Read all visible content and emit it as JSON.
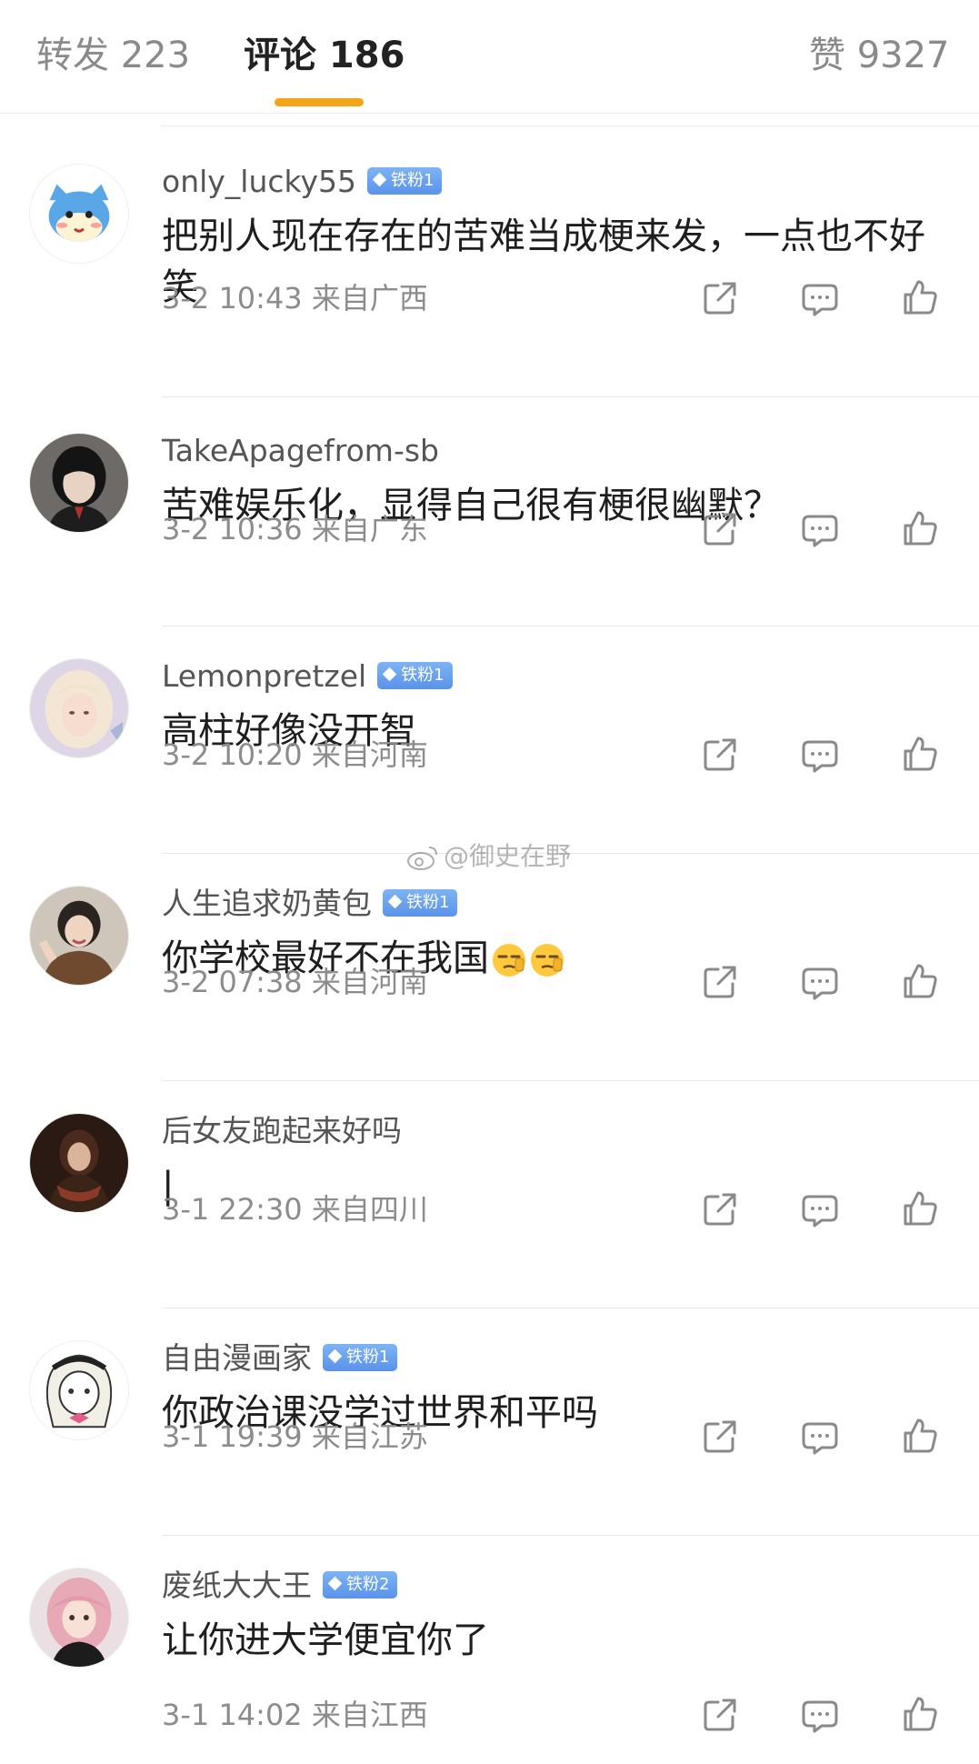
{
  "tabs": {
    "repost": "转发 223",
    "comments": "评论 186",
    "likes": "赞 9327"
  },
  "watermark": "@御史在野",
  "comments": [
    {
      "username": "only_lucky55",
      "badge": "铁粉1",
      "text": "把别人现在存在的苦难当成梗来发，一点也不好笑",
      "meta": "3-2 10:43 来自广西"
    },
    {
      "username": "TakeApagefrom-sb",
      "badge": "",
      "text": "苦难娱乐化，显得自己很有梗很幽默？",
      "meta": "3-2 10:36 来自广东"
    },
    {
      "username": "Lemonpretzel",
      "badge": "铁粉1",
      "text": "高柱好像没开智",
      "meta": "3-2 10:20 来自河南"
    },
    {
      "username": "人生追求奶黄包",
      "badge": "铁粉1",
      "text": "你学校最好不在我国",
      "meta": "3-2 07:38 来自河南"
    },
    {
      "username": "后女友跑起来好吗",
      "badge": "",
      "text": "|",
      "meta": "3-1 22:30 来自四川"
    },
    {
      "username": "自由漫画家",
      "badge": "铁粉1",
      "text": "你政治课没学过世界和平吗",
      "meta": "3-1 19:39 来自江苏"
    },
    {
      "username": "废纸大大王",
      "badge": "铁粉2",
      "text": "让你进大学便宜你了",
      "meta": "3-1 14:02 来自江西"
    }
  ],
  "colors": {
    "accent": "#f4a516",
    "badge": "#5a92ea",
    "meta": "#8c8c8c"
  }
}
